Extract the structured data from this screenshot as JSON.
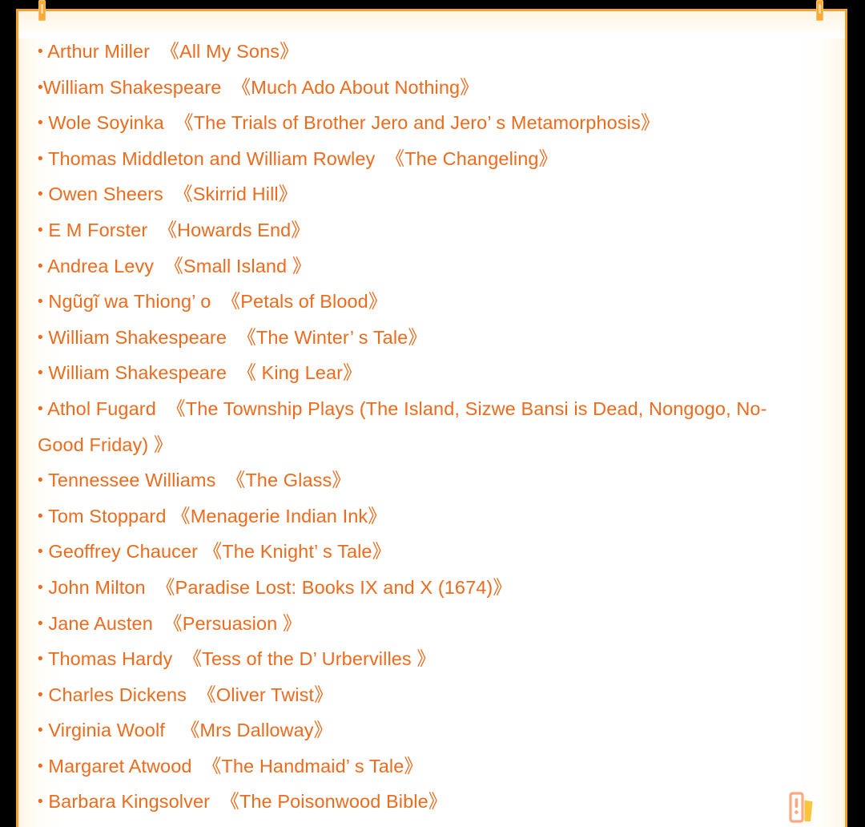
{
  "theme": {
    "text_color": "#EC6B1C",
    "frame_color": "#F7A22B",
    "handle_color": "#F9A93A",
    "page_background": "#FFFFFF",
    "outer_background": "#000000"
  },
  "frame": {
    "handle_left_name": "frame-handle-left",
    "handle_right_name": "frame-handle-right"
  },
  "icons": {
    "books": "books-icon"
  },
  "list": {
    "items": [
      {
        "bullet": "•",
        "gap": " ",
        "author": "Arthur Miller",
        "sep": "  ",
        "title": "《All My Sons》"
      },
      {
        "bullet": "•",
        "gap": "",
        "author": "William Shakespeare",
        "sep": "  ",
        "title": "《Much Ado About Nothing》"
      },
      {
        "bullet": "•",
        "gap": " ",
        "author": "Wole Soyinka",
        "sep": "  ",
        "title": "《The Trials of Brother Jero and Jero’  s Metamorphosis》"
      },
      {
        "bullet": "•",
        "gap": " ",
        "author": "Thomas Middleton and William Rowley",
        "sep": "  ",
        "title": "《The Changeling》"
      },
      {
        "bullet": "•",
        "gap": " ",
        "author": "Owen Sheers",
        "sep": "  ",
        "title": "《Skirrid Hill》"
      },
      {
        "bullet": "•",
        "gap": " ",
        "author": "E M Forster",
        "sep": "  ",
        "title": "《Howards End》"
      },
      {
        "bullet": "•",
        "gap": " ",
        "author": "Andrea Levy",
        "sep": "  ",
        "title": "《Small Island 》"
      },
      {
        "bullet": "•",
        "gap": " ",
        "author": "Ngũgĩ wa Thiong’  o",
        "sep": "  ",
        "title": "《Petals of Blood》"
      },
      {
        "bullet": "•",
        "gap": " ",
        "author": "William Shakespeare",
        "sep": "  ",
        "title": "《The Winter’  s Tale》"
      },
      {
        "bullet": "•",
        "gap": " ",
        "author": "William Shakespeare",
        "sep": "  ",
        "title": "《 King Lear》"
      },
      {
        "bullet": "•",
        "gap": " ",
        "author": "Athol Fugard",
        "sep": "  ",
        "title": "《The Township Plays (The Island, Sizwe Bansi is Dead, Nongogo, No-Good Friday) 》"
      },
      {
        "bullet": "•",
        "gap": " ",
        "author": "Tennessee Williams",
        "sep": "  ",
        "title": "《The Glass》"
      },
      {
        "bullet": "•",
        "gap": " ",
        "author": "Tom Stoppard",
        "sep": " ",
        "title": "《Menagerie Indian Ink》"
      },
      {
        "bullet": "•",
        "gap": " ",
        "author": "Geoffrey Chaucer",
        "sep": " ",
        "title": "《The Knight’  s Tale》"
      },
      {
        "bullet": "•",
        "gap": " ",
        "author": "John Milton",
        "sep": "  ",
        "title": "《Paradise Lost: Books IX and X (1674)》"
      },
      {
        "bullet": "•",
        "gap": " ",
        "author": "Jane Austen",
        "sep": "  ",
        "title": "《Persuasion 》"
      },
      {
        "bullet": "•",
        "gap": " ",
        "author": "Thomas Hardy",
        "sep": "  ",
        "title": "《Tess of the D’  Urbervilles 》"
      },
      {
        "bullet": "•",
        "gap": " ",
        "author": "Charles Dickens",
        "sep": "  ",
        "title": "《Oliver Twist》"
      },
      {
        "bullet": "•",
        "gap": " ",
        "author": "Virginia Woolf",
        "sep": "   ",
        "title": "《Mrs Dalloway》"
      },
      {
        "bullet": "•",
        "gap": " ",
        "author": "Margaret Atwood",
        "sep": "  ",
        "title": "《The Handmaid’  s Tale》"
      },
      {
        "bullet": "•",
        "gap": " ",
        "author": "Barbara Kingsolver",
        "sep": "  ",
        "title": "《The Poisonwood Bible》"
      }
    ]
  }
}
